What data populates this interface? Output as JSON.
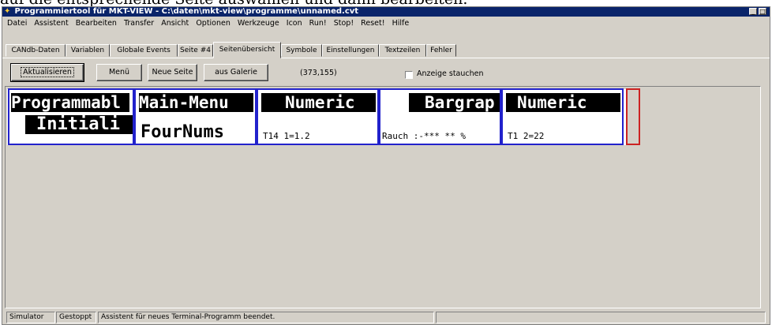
{
  "doc_text": "auf die entsprechende Seite auswählen und dann bearbeiten.",
  "window": {
    "title": "Programmiertool für MKT-VIEW - C:\\daten\\mkt-view\\programme\\unnamed.cvt",
    "app_icon": "app-icon"
  },
  "menu": [
    "Datei",
    "Assistent",
    "Bearbeiten",
    "Transfer",
    "Ansicht",
    "Optionen",
    "Werkzeuge",
    "Icon",
    "Run!",
    "Stop!",
    "Reset!",
    "Hilfe"
  ],
  "tabs": [
    "CANdb-Daten",
    "Variablen",
    "Globale Events",
    "Seite #4",
    "Seitenübersicht",
    "Symbole",
    "Einstellungen",
    "Textzeilen",
    "Fehler"
  ],
  "active_tab": "Seitenübersicht",
  "toolbar": {
    "refresh": "Aktualisieren",
    "menu": "Menü",
    "new_page": "Neue Seite",
    "from_gallery": "aus Galerie",
    "coords": "(373,155)",
    "compress_label": "Anzeige stauchen",
    "compress_checked": false
  },
  "pages": [
    {
      "header": "Programmabl",
      "line2": "Initiali",
      "small": ""
    },
    {
      "header": "Main-Menu",
      "line2": "FourNums",
      "small": ""
    },
    {
      "header": "Numeric",
      "line2": "",
      "small": "T14 1=1.2"
    },
    {
      "header": "Bargrap",
      "line2": "",
      "small": "Rauch    :-*** ** %"
    },
    {
      "header": "Numeric",
      "line2": "",
      "small": "T1 2=22"
    }
  ],
  "status": {
    "mode": "Simulator",
    "state": "Gestoppt",
    "message": "Assistent für neues Terminal-Programm beendet."
  },
  "colors": {
    "title_bar": "#0a246a",
    "page_frame": "#2222cc",
    "selected_empty_frame": "#cc2222",
    "face": "#d4d0c8"
  }
}
